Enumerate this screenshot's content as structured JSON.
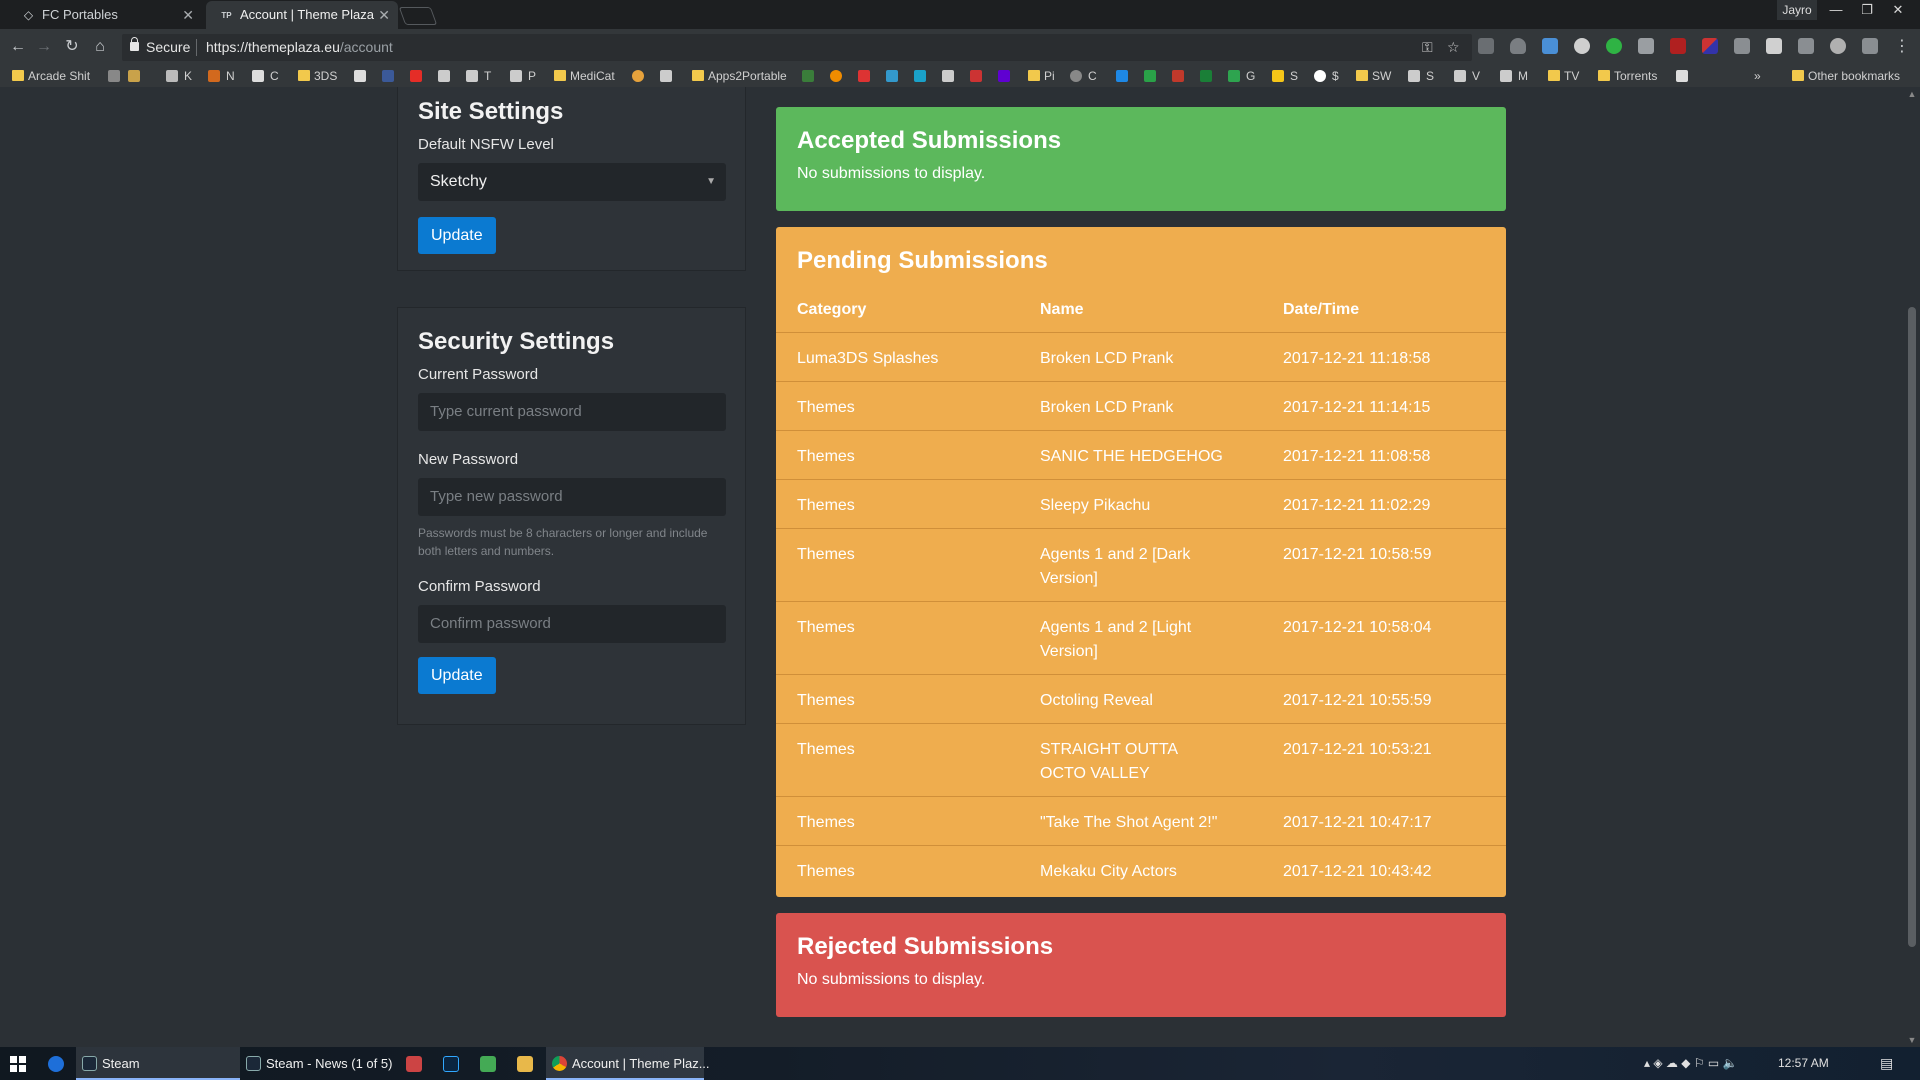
{
  "browser": {
    "tabs": [
      {
        "title": "FC Portables",
        "icon": "diamond-icon"
      },
      {
        "title": "Account | Theme Plaza",
        "icon": "tp-favicon-icon"
      }
    ],
    "profile": "Jayro",
    "controls": {
      "minimize": "—",
      "restore": "❐",
      "close": "✕"
    },
    "address": {
      "secure_label": "Secure",
      "url_host": "https://themeplaza.eu",
      "url_path": "/account"
    },
    "bookmarks": [
      {
        "label": "Arcade Shit",
        "type": "folder"
      },
      {
        "label": "K",
        "type": "link"
      },
      {
        "label": "N",
        "type": "link"
      },
      {
        "label": "C",
        "type": "link"
      },
      {
        "label": "3DS",
        "type": "folder"
      },
      {
        "label": "T",
        "type": "link"
      },
      {
        "label": "P",
        "type": "link"
      },
      {
        "label": "MediCat",
        "type": "folder"
      },
      {
        "label": "Apps2Portable",
        "type": "folder"
      },
      {
        "label": "Pi",
        "type": "link"
      },
      {
        "label": "C",
        "type": "link"
      },
      {
        "label": "G",
        "type": "link"
      },
      {
        "label": "S",
        "type": "link"
      },
      {
        "label": "$",
        "type": "link"
      },
      {
        "label": "SW",
        "type": "folder"
      },
      {
        "label": "S",
        "type": "link"
      },
      {
        "label": "V",
        "type": "link"
      },
      {
        "label": "M",
        "type": "link"
      },
      {
        "label": "TV",
        "type": "folder"
      },
      {
        "label": "Torrents",
        "type": "folder"
      }
    ],
    "more_bookmarks": "»",
    "other_bookmarks": "Other bookmarks"
  },
  "site_settings": {
    "title": "Site Settings",
    "nsfw_label": "Default NSFW Level",
    "nsfw_value": "Sketchy",
    "update_label": "Update"
  },
  "security_settings": {
    "title": "Security Settings",
    "current_label": "Current Password",
    "current_placeholder": "Type current password",
    "new_label": "New Password",
    "new_placeholder": "Type new password",
    "help": "Passwords must be 8 characters or longer and include both letters and numbers.",
    "confirm_label": "Confirm Password",
    "confirm_placeholder": "Confirm password",
    "update_label": "Update"
  },
  "accepted": {
    "title": "Accepted Submissions",
    "empty": "No submissions to display."
  },
  "pending": {
    "title": "Pending Submissions",
    "columns": [
      "Category",
      "Name",
      "Date/Time"
    ],
    "rows": [
      {
        "category": "Luma3DS Splashes",
        "name": "Broken LCD Prank",
        "datetime": "2017-12-21 11:18:58"
      },
      {
        "category": "Themes",
        "name": "Broken LCD Prank",
        "datetime": "2017-12-21 11:14:15"
      },
      {
        "category": "Themes",
        "name": "SANIC THE HEDGEHOG",
        "datetime": "2017-12-21 11:08:58"
      },
      {
        "category": "Themes",
        "name": "Sleepy Pikachu",
        "datetime": "2017-12-21 11:02:29"
      },
      {
        "category": "Themes",
        "name": "Agents 1 and 2 [Dark Version]",
        "datetime": "2017-12-21 10:58:59"
      },
      {
        "category": "Themes",
        "name": "Agents 1 and 2 [Light Version]",
        "datetime": "2017-12-21 10:58:04"
      },
      {
        "category": "Themes",
        "name": "Octoling Reveal",
        "datetime": "2017-12-21 10:55:59"
      },
      {
        "category": "Themes",
        "name": "STRAIGHT OUTTA OCTO VALLEY",
        "datetime": "2017-12-21 10:53:21"
      },
      {
        "category": "Themes",
        "name": "\"Take The Shot Agent 2!\"",
        "datetime": "2017-12-21 10:47:17"
      },
      {
        "category": "Themes",
        "name": "Mekaku City Actors",
        "datetime": "2017-12-21 10:43:42"
      }
    ]
  },
  "rejected": {
    "title": "Rejected Submissions",
    "empty": "No submissions to display."
  },
  "taskbar": {
    "items": [
      {
        "label": "Steam",
        "icon": "steam-icon",
        "active": true
      },
      {
        "label": "Steam - News (1 of 5)",
        "icon": "steam-icon",
        "active": false
      },
      {
        "label": "Account | Theme Plaz...",
        "icon": "chrome-icon",
        "active": true
      }
    ],
    "clock": "12:57 AM"
  },
  "colors": {
    "accepted": "#5cb85c",
    "pending": "#efad4e",
    "rejected": "#d9534f",
    "button": "#0b7ad1",
    "page_bg": "#2b3035"
  }
}
